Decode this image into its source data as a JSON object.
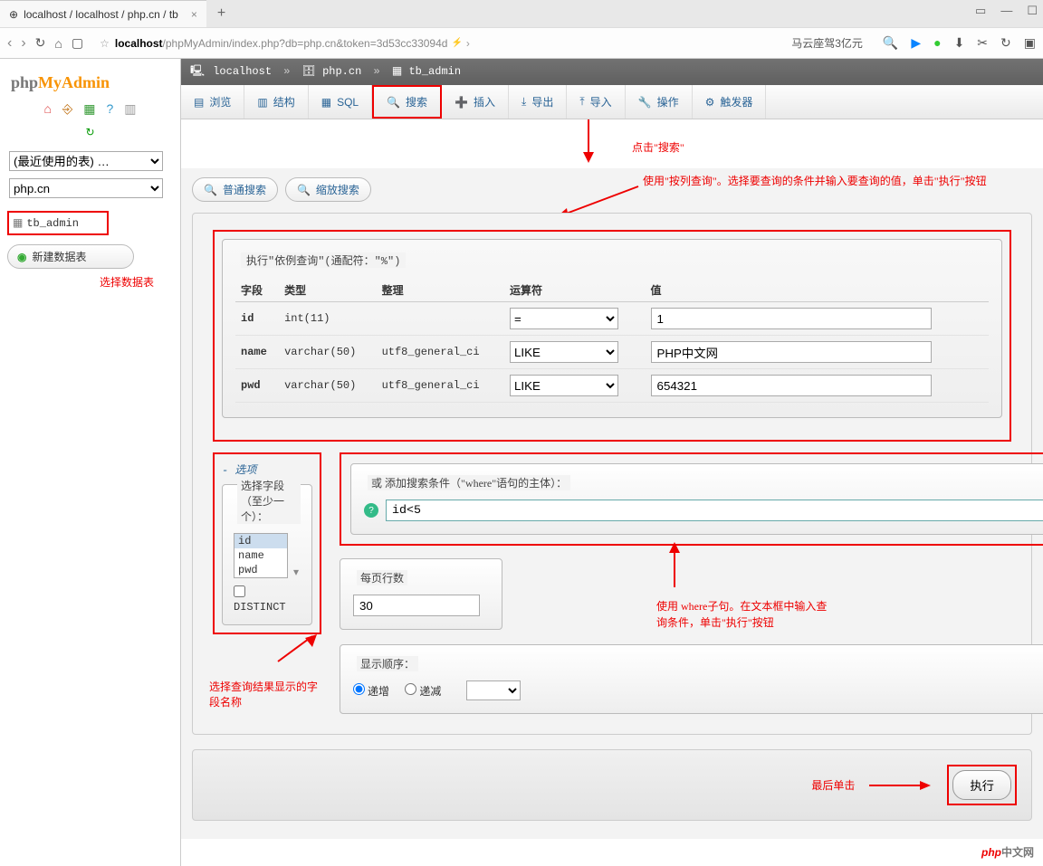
{
  "browser": {
    "tab_title": "localhost / localhost / php.cn / tb",
    "url_host": "localhost",
    "url_path": "/phpMyAdmin/index.php?db=php.cn&token=3d53cc33094d",
    "rhs_text": "马云座驾3亿元"
  },
  "sidebar": {
    "logo1": "php",
    "logo2": "MyAdmin",
    "recent_sel": "(最近使用的表) …",
    "db_sel": "php.cn",
    "table_name": "tb_admin",
    "new_table": "新建数据表",
    "anno_select_table": "选择数据表"
  },
  "breadcrumb": {
    "server": "localhost",
    "db": "php.cn",
    "table": "tb_admin"
  },
  "tabs": {
    "browse": "浏览",
    "structure": "结构",
    "sql": "SQL",
    "search": "搜索",
    "insert": "插入",
    "export": "导出",
    "import": "导入",
    "operations": "操作",
    "triggers": "触发器"
  },
  "anno": {
    "click_search": "点击\"搜索\"",
    "use_col_query": "使用\"按列查询\"。选择要查询的条件并输入要查询的值，单击\"执行\"按钮",
    "field_names": "选择查询结果显示的字段名称",
    "where_clause": "使用 where子句。在文本框中输入查询条件，单击\"执行\"按钮",
    "final_click": "最后单击"
  },
  "subtabs": {
    "normal": "普通搜索",
    "zoom": "缩放搜索"
  },
  "query_by_example": {
    "title": "执行\"依例查询\"(通配符：\"%\")",
    "headers": {
      "field": "字段",
      "type": "类型",
      "collation": "整理",
      "operator": "运算符",
      "value": "值"
    },
    "rows": [
      {
        "field": "id",
        "type": "int(11)",
        "collation": "",
        "op": "=",
        "val": "1"
      },
      {
        "field": "name",
        "type": "varchar(50)",
        "collation": "utf8_general_ci",
        "op": "LIKE",
        "val": "PHP中文网"
      },
      {
        "field": "pwd",
        "type": "varchar(50)",
        "collation": "utf8_general_ci",
        "op": "LIKE",
        "val": "654321"
      }
    ]
  },
  "options": {
    "section_label": "选项",
    "select_fields_legend": "选择字段（至少一个）：",
    "fields": [
      "id",
      "name",
      "pwd"
    ],
    "distinct": "DISTINCT"
  },
  "where": {
    "legend": "或 添加搜索条件（\"where\"语句的主体）：",
    "value": "id<5"
  },
  "rows_per_page": {
    "legend": "每页行数",
    "value": "30"
  },
  "order": {
    "legend": "显示顺序：",
    "asc": "递增",
    "desc": "递减"
  },
  "footer": {
    "exec": "执行"
  },
  "brand": {
    "p": "php",
    "cn": "中文网"
  }
}
